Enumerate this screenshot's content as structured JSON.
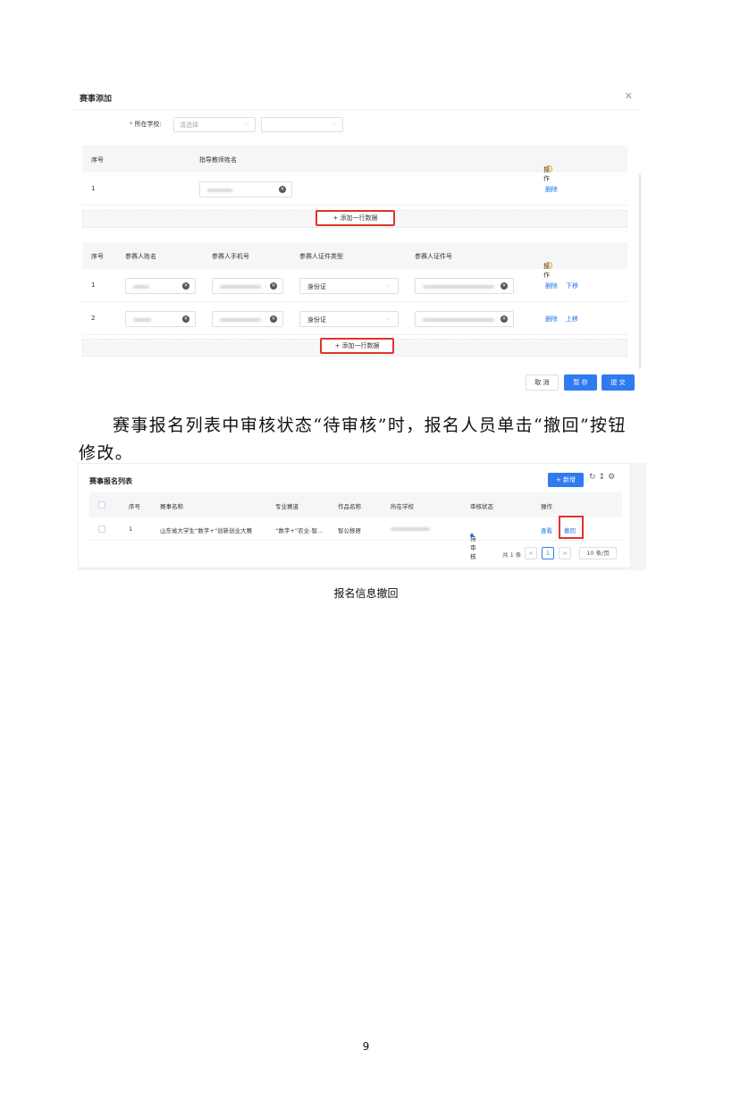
{
  "dialog": {
    "title": "赛事添加",
    "close_icon": "close-icon",
    "school": {
      "label": "所在学校:",
      "required_mark": "*",
      "select1_placeholder": "请选择",
      "select2_placeholder": ""
    },
    "teacher_table": {
      "headers": [
        "序号",
        "指导教师姓名",
        "操作"
      ],
      "rows": [
        {
          "index": "1",
          "action": "删除"
        }
      ],
      "add_row_label": "+ 添加一行数据"
    },
    "participant_table": {
      "headers": [
        "序号",
        "参赛人姓名",
        "参赛人手机号",
        "参赛人证件类型",
        "参赛人证件号",
        "操作"
      ],
      "rows": [
        {
          "index": "1",
          "id_type": "身份证",
          "actions": [
            "删除",
            "下移"
          ]
        },
        {
          "index": "2",
          "id_type": "身份证",
          "actions": [
            "删除",
            "上移"
          ]
        }
      ],
      "add_row_label": "+ 添加一行数据"
    },
    "footer": {
      "cancel": "取 消",
      "save": "暂 存",
      "submit": "提 交"
    }
  },
  "paragraph": "赛事报名列表中审核状态“待审核”时，报名人员单击“撤回”按钮修改。",
  "list": {
    "title": "赛事报名列表",
    "new_button": "+ 新增",
    "toolbar_icons": [
      "refresh-icon",
      "column-height-icon",
      "settings-icon"
    ],
    "headers": [
      "序号",
      "赛事名称",
      "专业赛道",
      "作品名称",
      "所在学校",
      "审核状态",
      "操作"
    ],
    "rows": [
      {
        "index": "1",
        "event": "山东省大学生“数字+”创新创业大赛",
        "track": "“数字+”农业-智...",
        "work": "智公移居",
        "status": "待审核",
        "actions": [
          "查看",
          "撤回"
        ]
      }
    ],
    "pagination": {
      "total": "共 1 条",
      "prev": "<",
      "current": "1",
      "next": ">",
      "page_size": "10 条/页"
    }
  },
  "caption": "报名信息撤回",
  "page_number": "9"
}
